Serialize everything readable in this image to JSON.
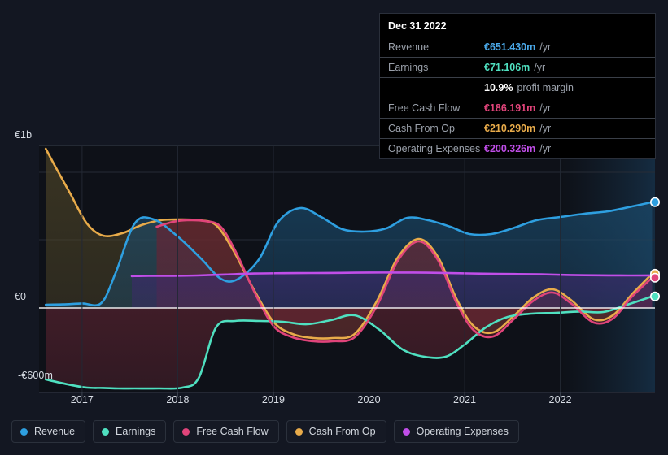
{
  "chart_data": {
    "type": "area",
    "title": "",
    "xlabel": "",
    "ylabel": "",
    "currency": "EUR",
    "xlim": [
      2016.55,
      2022.99
    ],
    "ylim": [
      -600,
      1050
    ],
    "y_axis": {
      "labels": [
        "€1b",
        "€0",
        "-€600m"
      ],
      "values": [
        1000,
        0,
        -600
      ],
      "gridlines": [
        1000,
        835,
        420,
        0,
        -520
      ],
      "zero_line": 0,
      "grid": true
    },
    "x_axis": {
      "tick_labels": [
        "2017",
        "2018",
        "2019",
        "2020",
        "2021",
        "2022"
      ],
      "tick_values": [
        2017,
        2018,
        2019,
        2020,
        2021,
        2022
      ]
    },
    "legend_position": "bottom",
    "units": "€ millions per year",
    "series": [
      {
        "name": "Revenue",
        "color": "#2e9fe0",
        "fill": "#1b4a6b",
        "x": [
          2016.62,
          2016.8,
          2017.0,
          2017.2,
          2017.35,
          2017.55,
          2017.75,
          2018.0,
          2018.25,
          2018.45,
          2018.62,
          2018.85,
          2019.05,
          2019.28,
          2019.5,
          2019.72,
          2019.95,
          2020.18,
          2020.4,
          2020.62,
          2020.85,
          2021.05,
          2021.28,
          2021.5,
          2021.75,
          2022.0,
          2022.25,
          2022.5,
          2022.75,
          2022.96
        ],
        "values": [
          20,
          22,
          28,
          30,
          215,
          520,
          545,
          440,
          300,
          180,
          175,
          300,
          530,
          615,
          560,
          485,
          470,
          490,
          555,
          540,
          500,
          455,
          455,
          490,
          540,
          560,
          580,
          595,
          625,
          651.43
        ]
      },
      {
        "name": "Earnings",
        "color": "#4fe0c0",
        "fill": "#5a2330",
        "x": [
          2016.62,
          2016.85,
          2017.05,
          2017.22,
          2017.38,
          2017.55,
          2017.8,
          2018.05,
          2018.22,
          2018.4,
          2018.6,
          2018.85,
          2019.1,
          2019.35,
          2019.6,
          2019.85,
          2020.1,
          2020.35,
          2020.58,
          2020.8,
          2021.0,
          2021.22,
          2021.45,
          2021.7,
          2021.95,
          2022.2,
          2022.45,
          2022.7,
          2022.96
        ],
        "values": [
          -440,
          -470,
          -490,
          -492,
          -495,
          -495,
          -495,
          -490,
          -430,
          -120,
          -80,
          -80,
          -85,
          -100,
          -75,
          -45,
          -130,
          -255,
          -300,
          -300,
          -225,
          -120,
          -55,
          -35,
          -30,
          -22,
          -25,
          20,
          71.106
        ]
      },
      {
        "name": "Free Cash Flow",
        "color": "#e0447a",
        "fill": "#6b2232",
        "x": [
          2017.78,
          2017.95,
          2018.1,
          2018.28,
          2018.45,
          2018.62,
          2018.8,
          2019.0,
          2019.2,
          2019.42,
          2019.62,
          2019.85,
          2020.08,
          2020.3,
          2020.52,
          2020.72,
          2020.92,
          2021.1,
          2021.3,
          2021.52,
          2021.72,
          2021.92,
          2022.12,
          2022.35,
          2022.55,
          2022.75,
          2022.96
        ],
        "values": [
          500,
          530,
          540,
          535,
          500,
          330,
          100,
          -110,
          -180,
          -205,
          -205,
          -180,
          10,
          290,
          410,
          295,
          25,
          -140,
          -175,
          -65,
          45,
          95,
          25,
          -90,
          -65,
          70,
          186.191
        ]
      },
      {
        "name": "Cash From Op",
        "color": "#e8ab4a",
        "fill": "#4d4427",
        "x": [
          2016.62,
          2016.72,
          2016.88,
          2017.05,
          2017.22,
          2017.42,
          2017.62,
          2017.82,
          2018.02,
          2018.22,
          2018.4,
          2018.58,
          2018.78,
          2019.0,
          2019.2,
          2019.42,
          2019.62,
          2019.85,
          2020.08,
          2020.3,
          2020.52,
          2020.72,
          2020.92,
          2021.1,
          2021.3,
          2021.52,
          2021.72,
          2021.92,
          2022.12,
          2022.35,
          2022.55,
          2022.75,
          2022.96
        ],
        "values": [
          980,
          870,
          700,
          520,
          445,
          460,
          510,
          540,
          545,
          540,
          510,
          355,
          130,
          -85,
          -160,
          -185,
          -185,
          -160,
          40,
          310,
          425,
          315,
          50,
          -115,
          -150,
          -45,
          65,
          115,
          45,
          -70,
          -45,
          85,
          210.29
        ]
      },
      {
        "name": "Operating Expenses",
        "color": "#c04ee8",
        "fill": "#3c2a6b",
        "x": [
          2017.52,
          2017.7,
          2017.95,
          2018.2,
          2018.5,
          2018.8,
          2019.1,
          2019.4,
          2019.7,
          2020.0,
          2020.3,
          2020.6,
          2020.9,
          2021.2,
          2021.5,
          2021.8,
          2022.1,
          2022.4,
          2022.7,
          2022.96
        ],
        "values": [
          196,
          198,
          198,
          200,
          206,
          212,
          214,
          215,
          216,
          218,
          218,
          217,
          214,
          211,
          209,
          207,
          203,
          201,
          200,
          200.326
        ]
      }
    ],
    "end_markers": [
      {
        "series": "Revenue",
        "value": 651.43,
        "color": "#2e9fe0"
      },
      {
        "series": "Operating Expenses",
        "value": 200.326,
        "color": "#c04ee8"
      },
      {
        "series": "Cash From Op",
        "value": 210.29,
        "color": "#e8ab4a"
      },
      {
        "series": "Free Cash Flow",
        "value": 186.191,
        "color": "#e0447a"
      },
      {
        "series": "Earnings",
        "value": 71.106,
        "color": "#4fe0c0"
      }
    ]
  },
  "tooltip": {
    "title": "Dec 31 2022",
    "rows": [
      {
        "key": "Revenue",
        "value": "€651.430m",
        "unit": "/yr",
        "color": "#4aa8e8"
      },
      {
        "key": "Earnings",
        "value": "€71.106m",
        "unit": "/yr",
        "color": "#4fe0c0"
      },
      {
        "key": "",
        "value": "10.9%",
        "unit": "profit margin",
        "color": "#ffffff"
      },
      {
        "key": "Free Cash Flow",
        "value": "€186.191m",
        "unit": "/yr",
        "color": "#e0447a"
      },
      {
        "key": "Cash From Op",
        "value": "€210.290m",
        "unit": "/yr",
        "color": "#e8ab4a"
      },
      {
        "key": "Operating Expenses",
        "value": "€200.326m",
        "unit": "/yr",
        "color": "#c04ee8"
      }
    ]
  },
  "legend": {
    "items": [
      {
        "label": "Revenue",
        "color": "#2e9fe0"
      },
      {
        "label": "Earnings",
        "color": "#4fe0c0"
      },
      {
        "label": "Free Cash Flow",
        "color": "#e0447a"
      },
      {
        "label": "Cash From Op",
        "color": "#e8ab4a"
      },
      {
        "label": "Operating Expenses",
        "color": "#c04ee8"
      }
    ]
  },
  "theme": {
    "background": "#131722",
    "plot_background": "#0e1118",
    "grid_color": "#272c36",
    "zero_line_color": "#ffffff"
  }
}
